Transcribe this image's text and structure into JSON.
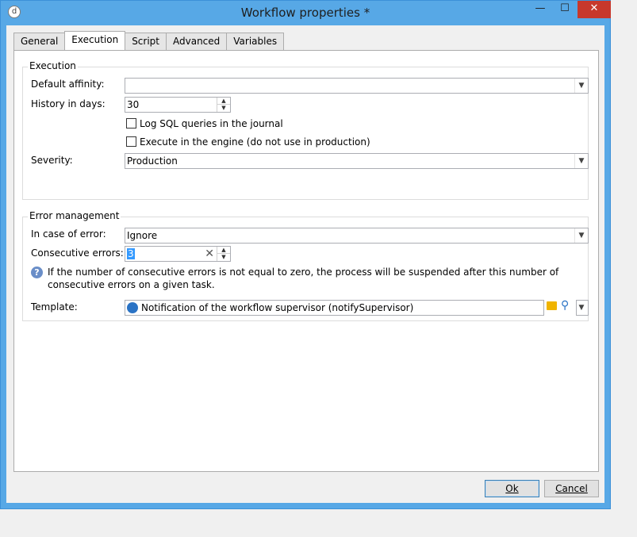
{
  "window": {
    "title": "Workflow properties *",
    "app_icon": "application-icon",
    "minimize": "—",
    "maximize": "☐",
    "close": "✕"
  },
  "tabs": [
    {
      "label": "General"
    },
    {
      "label": "Execution",
      "active": true
    },
    {
      "label": "Script"
    },
    {
      "label": "Advanced"
    },
    {
      "label": "Variables"
    }
  ],
  "execution": {
    "group_title": "Execution",
    "default_affinity_label": "Default affinity:",
    "default_affinity_value": "",
    "history_label": "History in days:",
    "history_value": "30",
    "log_sql_label": "Log SQL queries in the journal",
    "execute_engine_label": "Execute in the engine (do not use in production)",
    "severity_label": "Severity:",
    "severity_value": "Production"
  },
  "error_management": {
    "group_title": "Error management",
    "in_case_label": "In case of error:",
    "in_case_value": "Ignore",
    "consecutive_label": "Consecutive errors:",
    "consecutive_value": "3",
    "note": "If the number of consecutive errors is not equal to zero, the process will be suspended after this number of consecutive errors on a given task.",
    "template_label": "Template:",
    "template_value": "Notification of the workflow supervisor (notifySupervisor)"
  },
  "buttons": {
    "ok": "Ok",
    "cancel": "Cancel"
  },
  "colors": {
    "title_bar": "#57a8e6",
    "close_button": "#c7382c",
    "selection": "#3399ff"
  }
}
